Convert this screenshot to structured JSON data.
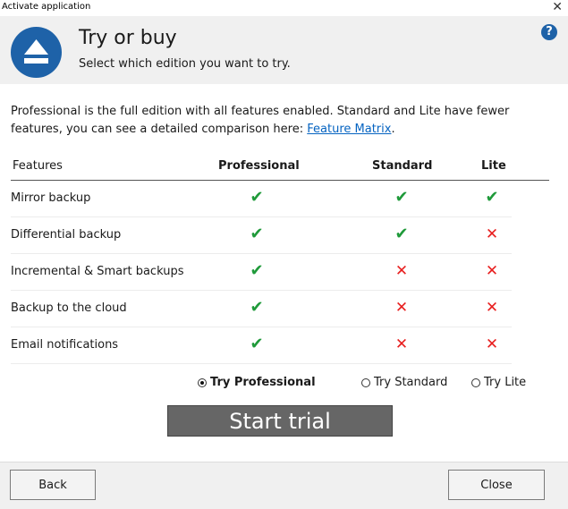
{
  "window": {
    "title": "Activate application",
    "close_glyph": "✕"
  },
  "header": {
    "title": "Try or buy",
    "subtitle": "Select which edition you want to try.",
    "help_glyph": "?",
    "accent_color": "#1e62a8"
  },
  "intro": {
    "text": "Professional is the full edition with all features enabled. Standard and Lite have fewer features, you can see a detailed comparison here: ",
    "link": "Feature Matrix",
    "suffix": "."
  },
  "table": {
    "columns": [
      "Features",
      "Professional",
      "Standard",
      "Lite"
    ],
    "rows": [
      {
        "feature": "Mirror backup",
        "professional": true,
        "standard": true,
        "lite": true
      },
      {
        "feature": "Differential backup",
        "professional": true,
        "standard": true,
        "lite": false
      },
      {
        "feature": "Incremental & Smart backups",
        "professional": true,
        "standard": false,
        "lite": false
      },
      {
        "feature": "Backup to the cloud",
        "professional": true,
        "standard": false,
        "lite": false
      },
      {
        "feature": "Email notifications",
        "professional": true,
        "standard": false,
        "lite": false
      }
    ],
    "check_glyph": "✔",
    "cross_glyph": "✕",
    "check_color": "#1f9a3a",
    "cross_color": "#e81e1e"
  },
  "trial_options": [
    {
      "label": "Try Professional",
      "selected": true
    },
    {
      "label": "Try Standard",
      "selected": false
    },
    {
      "label": "Try Lite",
      "selected": false
    }
  ],
  "start_button": "Start trial",
  "footer": {
    "back_label": "Back",
    "close_label": "Close"
  }
}
